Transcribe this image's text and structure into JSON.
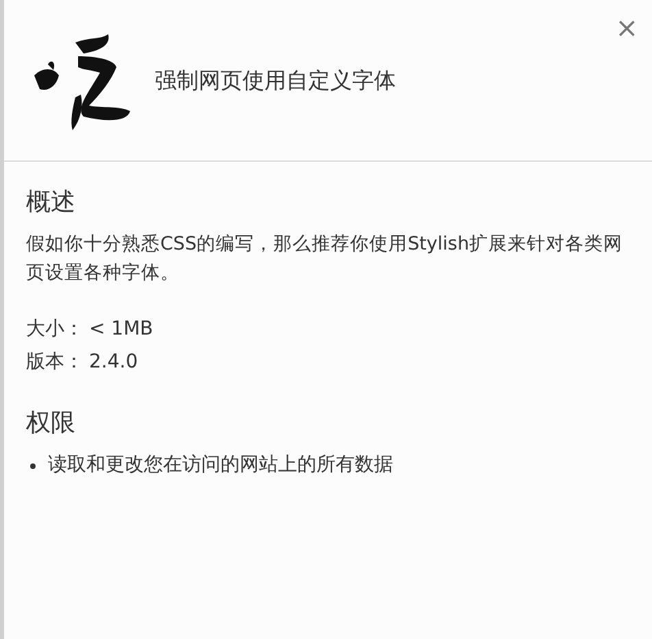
{
  "header": {
    "title": "强制网页使用自定义字体",
    "close": "×"
  },
  "overview": {
    "heading": "概述",
    "description": "假如你十分熟悉CSS的编写，那么推荐你使用Stylish扩展来针对各类网页设置各种字体。",
    "details": [
      {
        "label": "大小：",
        "value": "< 1MB"
      },
      {
        "label": "版本：",
        "value": "2.4.0"
      }
    ]
  },
  "permissions": {
    "heading": "权限",
    "items": [
      "读取和更改您在访问的网站上的所有数据"
    ]
  }
}
